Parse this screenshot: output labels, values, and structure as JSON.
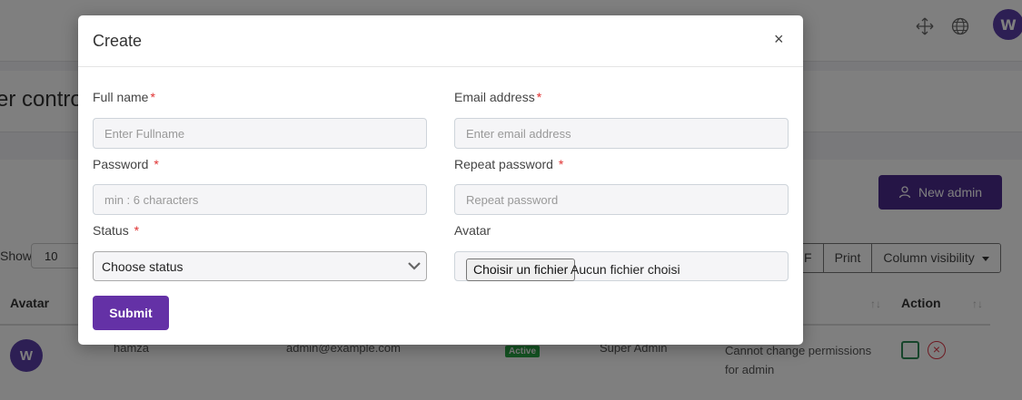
{
  "background": {
    "page_title": "er contro",
    "new_admin_label": "New admin",
    "show_label": "Show",
    "show_value": "10",
    "toolbar_buttons": [
      "F",
      "Print",
      "Column visibility"
    ],
    "table": {
      "headers": [
        "Avatar",
        "Action"
      ],
      "row": {
        "name": "hamza",
        "email": "admin@example.com",
        "status": "Active",
        "role": "Super Admin",
        "permissions_note": "Cannot change permissions for admin"
      }
    },
    "colors": {
      "primary": "#4b2a8c",
      "active_badge": "#28a745",
      "delete": "#dc3545"
    }
  },
  "modal": {
    "title": "Create",
    "close_symbol": "×",
    "fields": {
      "full_name": {
        "label": "Full name",
        "required": "*",
        "placeholder": "Enter Fullname"
      },
      "email": {
        "label": "Email address",
        "required": "*",
        "placeholder": "Enter email address"
      },
      "password": {
        "label": "Password",
        "required": "*",
        "placeholder": "min : 6 characters"
      },
      "repeat_password": {
        "label": "Repeat password",
        "required": "*",
        "placeholder": "Repeat password"
      },
      "status": {
        "label": "Status",
        "required": "*",
        "selected": "Choose status"
      },
      "avatar": {
        "label": "Avatar",
        "button_label": "Choisir un fichier",
        "no_file_text": "Aucun fichier choisi"
      }
    },
    "submit_label": "Submit",
    "submit_color": "#6431a6"
  }
}
